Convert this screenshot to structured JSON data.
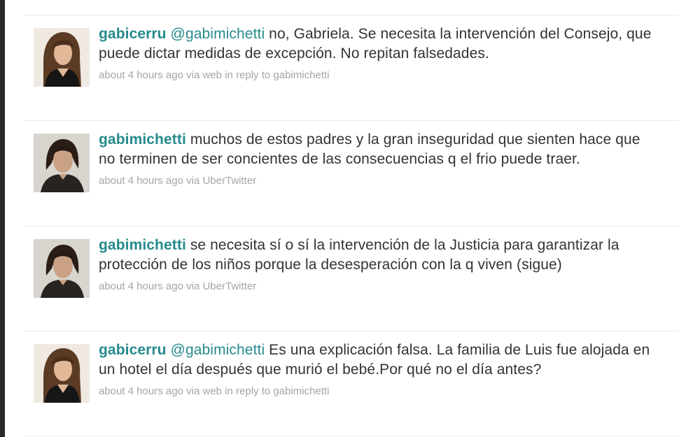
{
  "tweets": [
    {
      "screen_name": "gabicerru",
      "mention": "@gabimichetti",
      "text": " no, Gabriela. Se necesita la intervención del Consejo, que puede dictar medidas de excepción. No repitan falsedades.",
      "time": "about 4 hours ago",
      "via": "via",
      "source": "web",
      "in_reply_to_prefix": "in reply to",
      "in_reply_to": "gabimichetti",
      "avatar_icon": "woman-long-hair-avatar"
    },
    {
      "screen_name": "gabimichetti",
      "mention": "",
      "text": " muchos de estos padres y la gran inseguridad que sienten hace que no terminen de ser concientes de las consecuencias q el frio puede traer.",
      "time": "about 4 hours ago",
      "via": "via",
      "source": "UberTwitter",
      "in_reply_to_prefix": "",
      "in_reply_to": "",
      "avatar_icon": "woman-short-hair-avatar"
    },
    {
      "screen_name": "gabimichetti",
      "mention": "",
      "text": " se necesita sí o sí la intervención de la Justicia para garantizar la protección de los niños porque la desesperación con la q viven (sigue)",
      "time": "about 4 hours ago",
      "via": "via",
      "source": "UberTwitter",
      "in_reply_to_prefix": "",
      "in_reply_to": "",
      "avatar_icon": "woman-short-hair-avatar"
    },
    {
      "screen_name": "gabicerru",
      "mention": "@gabimichetti",
      "text": " Es una explicación falsa. La familia de Luis fue alojada en un hotel el día después que murió el bebé.Por qué no el día antes?",
      "time": "about 4 hours ago",
      "via": "via",
      "source": "web",
      "in_reply_to_prefix": "in reply to",
      "in_reply_to": "gabimichetti",
      "avatar_icon": "woman-long-hair-avatar"
    }
  ],
  "colors": {
    "screen_name": "#268a8c",
    "text": "#333333",
    "meta": "#a5a5a5",
    "divider": "#e8e8e8",
    "left_border": "#2a2a2a"
  }
}
